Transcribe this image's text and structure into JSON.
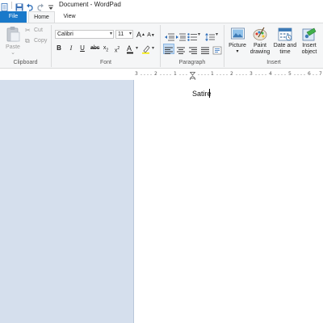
{
  "window": {
    "title": "Document - WordPad"
  },
  "tabs": {
    "file": "File",
    "home": "Home",
    "view": "View"
  },
  "ribbon": {
    "clipboard": {
      "label": "Clipboard",
      "paste": "Paste",
      "cut": "Cut",
      "copy": "Copy"
    },
    "font": {
      "label": "Font",
      "family": "Calibri",
      "size": "11"
    },
    "paragraph": {
      "label": "Paragraph"
    },
    "insert": {
      "label": "Insert",
      "picture": "Picture",
      "paint_line1": "Paint",
      "paint_line2": "drawing",
      "date_line1": "Date and",
      "date_line2": "time",
      "object_line1": "Insert",
      "object_line2": "object"
    }
  },
  "ruler": {
    "marks": [
      "3",
      "2",
      "1",
      "1",
      "2",
      "3",
      "4",
      "5",
      "6",
      "7"
    ]
  },
  "document": {
    "text": "Satire"
  },
  "colors": {
    "file_tab": "#1979ca",
    "workspace": "#d5dfed",
    "ribbon_bg": "#f5f6f7"
  }
}
